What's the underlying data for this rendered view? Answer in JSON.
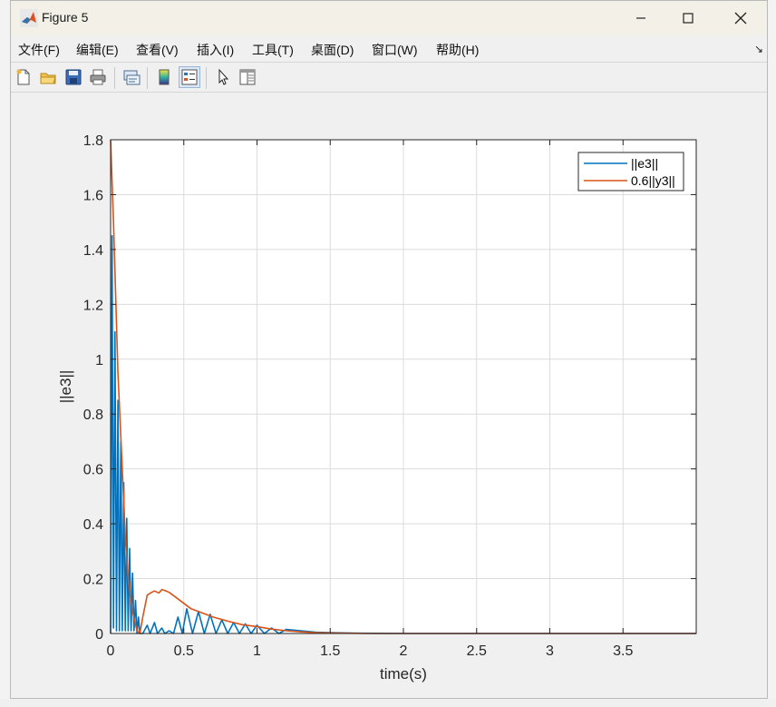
{
  "window": {
    "title": "Figure 5"
  },
  "menu": {
    "items": [
      "文件(F)",
      "编辑(E)",
      "查看(V)",
      "插入(I)",
      "工具(T)",
      "桌面(D)",
      "窗口(W)",
      "帮助(H)"
    ]
  },
  "toolbar": {
    "buttons": [
      "new-figure-icon",
      "open-icon",
      "save-icon",
      "print-icon",
      "link-icon",
      "colorbar-icon",
      "legend-icon",
      "pointer-icon",
      "property-editor-icon"
    ]
  },
  "colors": {
    "series1": "#0072BD",
    "series2": "#D95319",
    "axes_bg": "#ffffff",
    "figure_bg": "#f0f0f0"
  },
  "chart_data": {
    "type": "line",
    "title": "",
    "xlabel": "time(s)",
    "ylabel": "||e3||",
    "xlim": [
      0,
      4
    ],
    "ylim": [
      0,
      1.8
    ],
    "xticks": [
      0,
      0.5,
      1,
      1.5,
      2,
      2.5,
      3,
      3.5
    ],
    "xtick_labels": [
      "0",
      "0.5",
      "1",
      "1.5",
      "2",
      "2.5",
      "3",
      "3.5"
    ],
    "yticks": [
      0,
      0.2,
      0.4,
      0.6,
      0.8,
      1,
      1.2,
      1.4,
      1.6,
      1.8
    ],
    "ytick_labels": [
      "0",
      "0.2",
      "0.4",
      "0.6",
      "0.8",
      "1",
      "1.2",
      "1.4",
      "1.6",
      "1.8"
    ],
    "grid": true,
    "legend_position": "top-right",
    "series": [
      {
        "name": "||e3||",
        "x": [
          0,
          0.01,
          0.02,
          0.03,
          0.04,
          0.05,
          0.06,
          0.07,
          0.08,
          0.09,
          0.1,
          0.11,
          0.12,
          0.13,
          0.14,
          0.15,
          0.16,
          0.17,
          0.18,
          0.19,
          0.2,
          0.22,
          0.25,
          0.27,
          0.3,
          0.32,
          0.35,
          0.37,
          0.4,
          0.43,
          0.46,
          0.49,
          0.52,
          0.56,
          0.6,
          0.64,
          0.68,
          0.72,
          0.76,
          0.8,
          0.84,
          0.88,
          0.92,
          0.96,
          1.0,
          1.05,
          1.1,
          1.15,
          1.2,
          1.3,
          1.4,
          1.5,
          1.7,
          2.0,
          3.0,
          4.0
        ],
        "y": [
          0,
          1.45,
          0.02,
          1.1,
          0.01,
          0.85,
          0.01,
          0.7,
          0.01,
          0.55,
          0.01,
          0.42,
          0.01,
          0.31,
          0.01,
          0.22,
          0.01,
          0.12,
          0.0,
          0.06,
          0.0,
          0.0,
          0.03,
          0.0,
          0.04,
          0.0,
          0.02,
          0.0,
          0.01,
          0.0,
          0.06,
          0.0,
          0.09,
          0.0,
          0.08,
          0.0,
          0.07,
          0.0,
          0.05,
          0.0,
          0.04,
          0.0,
          0.035,
          0.0,
          0.03,
          0.0,
          0.02,
          0.0,
          0.015,
          0.01,
          0.005,
          0.003,
          0.001,
          0.0,
          0.0,
          0.0
        ]
      },
      {
        "name": "0.6||y3||",
        "x": [
          0,
          0.02,
          0.05,
          0.08,
          0.1,
          0.12,
          0.15,
          0.18,
          0.2,
          0.22,
          0.25,
          0.28,
          0.3,
          0.33,
          0.35,
          0.38,
          0.4,
          0.45,
          0.5,
          0.55,
          0.6,
          0.7,
          0.8,
          0.9,
          1.0,
          1.1,
          1.2,
          1.3,
          1.4,
          1.5,
          1.6,
          1.8,
          2.0,
          2.5,
          3.0,
          3.5,
          4.0
        ],
        "y": [
          1.8,
          1.5,
          0.95,
          0.6,
          0.35,
          0.2,
          0.08,
          0.01,
          0.0,
          0.06,
          0.14,
          0.15,
          0.155,
          0.148,
          0.16,
          0.155,
          0.15,
          0.13,
          0.11,
          0.09,
          0.08,
          0.06,
          0.045,
          0.032,
          0.025,
          0.016,
          0.01,
          0.006,
          0.003,
          0.002,
          0.001,
          0.0,
          0.0,
          0.0,
          0.0,
          0.0,
          0.0
        ]
      }
    ]
  }
}
